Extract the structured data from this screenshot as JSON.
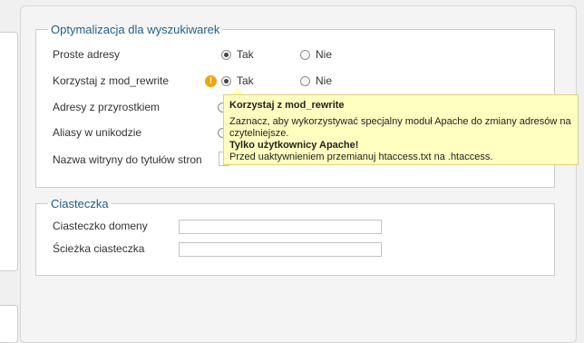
{
  "seo": {
    "legend": "Optymalizacja dla wyszukiwarek",
    "rows": [
      {
        "label": "Proste adresy",
        "yes": "Tak",
        "no": "Nie",
        "value": "Tak"
      },
      {
        "label": "Korzystaj z mod_rewrite",
        "yes": "Tak",
        "no": "Nie",
        "value": "Tak"
      },
      {
        "label": "Adresy z przyrostkiem"
      },
      {
        "label": "Aliasy w unikodzie"
      },
      {
        "label": "Nazwa witryny do tytułów stron"
      }
    ]
  },
  "tooltip": {
    "title": "Korzystaj z mod_rewrite",
    "line1": "Zaznacz, aby wykorzystywać specjalny moduł Apache do zmiany adresów na",
    "line2": "czytelniejsze.",
    "line3": "Tylko użytkownicy Apache!",
    "line4": "Przed uaktywnieniem przemianuj htaccess.txt na .htaccess."
  },
  "cookie": {
    "legend": "Ciasteczka",
    "domain_label": "Ciasteczko domeny",
    "domain_value": "",
    "path_label": "Ścieżka ciasteczka",
    "path_value": ""
  },
  "icons": {
    "warning": "exclamation-warning-icon",
    "warning_color": "#f0a30a"
  }
}
